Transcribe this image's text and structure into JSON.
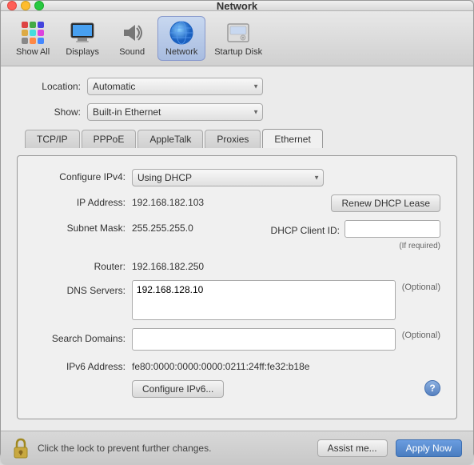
{
  "window": {
    "title": "Network"
  },
  "toolbar": {
    "items": [
      {
        "id": "show-all",
        "label": "Show All",
        "icon": "grid"
      },
      {
        "id": "displays",
        "label": "Displays",
        "icon": "display"
      },
      {
        "id": "sound",
        "label": "Sound",
        "icon": "speaker"
      },
      {
        "id": "network",
        "label": "Network",
        "icon": "globe",
        "active": true
      },
      {
        "id": "startup-disk",
        "label": "Startup Disk",
        "icon": "disk"
      }
    ]
  },
  "location": {
    "label": "Location:",
    "value": "Automatic"
  },
  "show": {
    "label": "Show:",
    "value": "Built-in Ethernet"
  },
  "tabs": [
    {
      "id": "tcpip",
      "label": "TCP/IP",
      "active": true
    },
    {
      "id": "pppoe",
      "label": "PPPoE"
    },
    {
      "id": "appletalk",
      "label": "AppleTalk"
    },
    {
      "id": "proxies",
      "label": "Proxies"
    },
    {
      "id": "ethernet",
      "label": "Ethernet"
    }
  ],
  "panel": {
    "configure_ipv4": {
      "label": "Configure IPv4:",
      "value": "Using DHCP"
    },
    "ip_address": {
      "label": "IP Address:",
      "value": "192.168.182.103"
    },
    "renew_dhcp": {
      "label": "Renew DHCP Lease"
    },
    "subnet_mask": {
      "label": "Subnet Mask:",
      "value": "255.255.255.0"
    },
    "dhcp_client_id": {
      "label": "DHCP Client ID:",
      "placeholder": "",
      "if_required": "(If required)"
    },
    "router": {
      "label": "Router:",
      "value": "192.168.182.250"
    },
    "dns_servers": {
      "label": "DNS Servers:",
      "value": "192.168.128.10",
      "optional": "(Optional)"
    },
    "search_domains": {
      "label": "Search Domains:",
      "value": "",
      "optional": "(Optional)"
    },
    "ipv6_address": {
      "label": "IPv6 Address:",
      "value": "fe80:0000:0000:0000:0211:24ff:fe32:b18e"
    },
    "configure_ipv6": {
      "label": "Configure IPv6..."
    }
  },
  "bottom": {
    "lock_text": "Click the lock to prevent further changes.",
    "assist_label": "Assist me...",
    "apply_label": "Apply Now"
  }
}
